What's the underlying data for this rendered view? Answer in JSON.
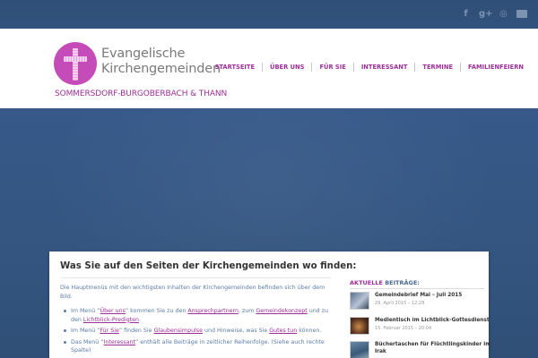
{
  "social": {
    "icons": [
      {
        "name": "facebook-icon",
        "glyph": "f"
      },
      {
        "name": "google-plus-icon",
        "glyph": "g+"
      },
      {
        "name": "instagram-icon",
        "glyph": "◎"
      },
      {
        "name": "mail-icon",
        "glyph": ""
      }
    ]
  },
  "logo": {
    "line1": "Evangelische",
    "line2": "Kirchengemeinden",
    "subtitle": "SOMMERSDORF-BURGOBERBACH & THANN",
    "color": "#c54bb8"
  },
  "nav": {
    "items": [
      "STARTSEITE",
      "ÜBER UNS",
      "FÜR SIE",
      "INTERESSANT",
      "TERMINE",
      "FAMILIENFEIERN"
    ]
  },
  "main": {
    "title": "Was Sie auf den Seiten der Kirchengemeinden wo finden:",
    "intro": "Die Hauptmenüs mit den wichtigsten Inhalten der Kirchengemeinden befinden sich über dem Bild.",
    "b1": {
      "pre": "Im Menü “",
      "l1": "Über uns",
      "mid1": "” kommen Sie zu den ",
      "l2": "Ansprechpartnern",
      "mid2": ", zum ",
      "l3": "Gemeindekonzept",
      "mid3": " und zu den ",
      "l4": "Lichtblick-Predigten",
      "end": "."
    },
    "b2": {
      "pre": "Im Menü “",
      "l1": "Für Sie",
      "mid1": "” finden Sie ",
      "l2": "Glaubensimpulse",
      "mid2": " und Hinweise, was Sie ",
      "l3": "Gutes tun",
      "end": " können."
    },
    "b3": {
      "pre": "Das Menü “",
      "l1": "Interessant",
      "end": "” enthält alle Beiträge in zeitlicher Reihenfolge. (Siehe auch rechte Spalte)"
    }
  },
  "sidebar": {
    "heading_a": "AKTUELLE",
    "heading_b": " BEITRÄGE:",
    "posts": [
      {
        "title": "Gemeindebrief Mai – Juli 2015",
        "date": "29. April 2015 – 12:28"
      },
      {
        "title": "Medientisch im Lichtblick-Gottesdienst",
        "date": "15. Februar 2015 – 20:04"
      },
      {
        "title": "Büchertaschen für Flüchtlingskinder im",
        "title2": "Irak",
        "date": ""
      }
    ]
  }
}
